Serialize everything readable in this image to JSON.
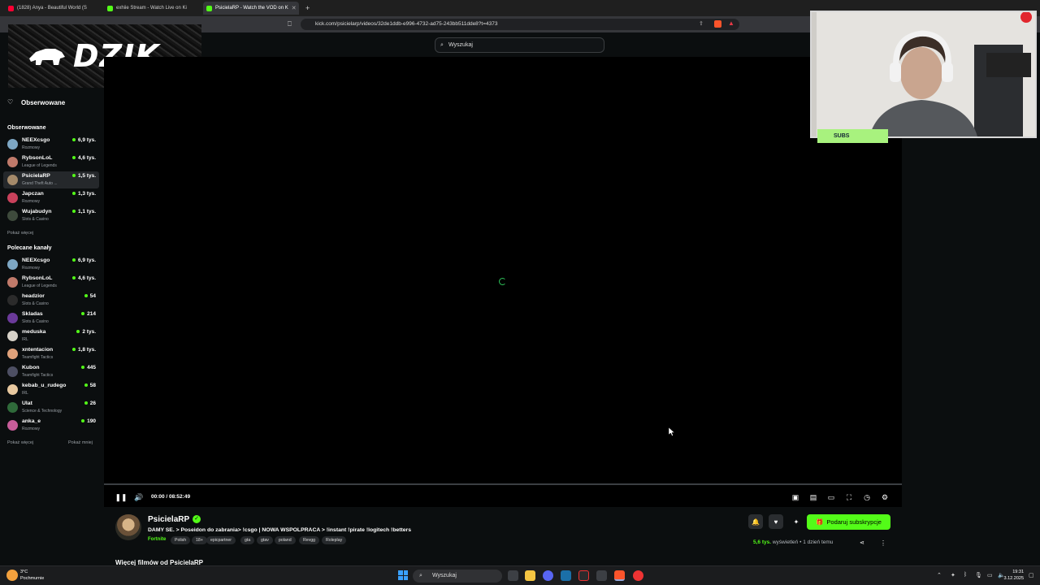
{
  "browser": {
    "tabs": [
      {
        "label": "(1828) Anya - Beautiful World (S",
        "color": "#ff0033"
      },
      {
        "label": "exhiie Stream - Watch Live on Ki",
        "color": "#53fc18"
      },
      {
        "label": "PsicielaRP - Watch the VOD on K",
        "color": "#53fc18"
      }
    ],
    "new_tab": "+",
    "url": "kick.com/psicielarp/videos/32de1ddb-e996-4732-ad75-243bb511dde8?t=4373"
  },
  "logo": {
    "text": "DZIK"
  },
  "search": {
    "placeholder": "Wyszukaj"
  },
  "sidebar": {
    "followed_nav": "Obserwowane",
    "followed_heading": "Obserwowane",
    "followed": [
      {
        "name": "NEEXcsgo",
        "category": "Rozmowy",
        "viewers": "6,9 tys.",
        "color": "#7da7c4"
      },
      {
        "name": "RybsonLoL",
        "category": "League of Legends",
        "viewers": "4,6 tys.",
        "color": "#c07a6a"
      },
      {
        "name": "PsicielaRP",
        "category": "Grand Theft Auto ...",
        "viewers": "1,5 tys.",
        "color": "#a58a6a"
      },
      {
        "name": "Japczan",
        "category": "Rozmowy",
        "viewers": "1,3 tys.",
        "color": "#c9415b"
      },
      {
        "name": "Wujabudyn",
        "category": "Slots & Casino",
        "viewers": "1,1 tys.",
        "color": "#3e4a3c"
      }
    ],
    "show_more_1": "Pokaż więcej",
    "recommended_heading": "Polecane kanały",
    "recommended": [
      {
        "name": "NEEXcsgo",
        "category": "Rozmowy",
        "viewers": "6,9 tys.",
        "color": "#7da7c4"
      },
      {
        "name": "RybsonLoL",
        "category": "League of Legends",
        "viewers": "4,6 tys.",
        "color": "#c07a6a"
      },
      {
        "name": "headzior",
        "category": "Slots & Casino",
        "viewers": "54",
        "color": "#2b2b2b"
      },
      {
        "name": "Skladas",
        "category": "Slots & Casino",
        "viewers": "214",
        "color": "#6b3a9a"
      },
      {
        "name": "meduska",
        "category": "IRL",
        "viewers": "2 tys.",
        "color": "#d7d2c8"
      },
      {
        "name": "xntentacion",
        "category": "Teamfight Tactics",
        "viewers": "1,8 tys.",
        "color": "#e0a27b"
      },
      {
        "name": "Kubon",
        "category": "Teamfight Tactics",
        "viewers": "445",
        "color": "#4d4f63"
      },
      {
        "name": "kebab_u_rudego",
        "category": "IRL",
        "viewers": "58",
        "color": "#e8c9a0"
      },
      {
        "name": "Ulat",
        "category": "Science & Technology",
        "viewers": "26",
        "color": "#2f6a3a"
      },
      {
        "name": "anka_e",
        "category": "Rozmowy",
        "viewers": "190",
        "color": "#c75d9a"
      }
    ],
    "show_more_2": "Pokaż więcej",
    "show_less": "Pokaż mniej"
  },
  "player": {
    "time": "00:00 / 08:52:49",
    "progress_fraction": 0
  },
  "channel": {
    "name": "PsicielaRP",
    "title": "DAMY SE. > Poseidon do zabrania> !csgo   | NOWA WSPOLPRACA > !instant  !pirate !logitech !betters",
    "category": "Fortnite",
    "tags": [
      "Polish",
      "18+",
      "epicpartner",
      "gta",
      "gtav",
      "poland",
      "Revgg",
      "Roleplay"
    ],
    "subscribe_label": "Podaruj subskrypcje",
    "views": "5,6 tys.",
    "views_label": "wyświetleń",
    "separator": "•",
    "age": "1 dzień temu",
    "more_videos": "Więcej filmów od PsicielaRP"
  },
  "overlay": {
    "subs_label": "SUBS"
  },
  "taskbar": {
    "search_placeholder": "Wyszukaj",
    "weather_temp": "3°C",
    "weather_desc": "Pochmurnie",
    "time": "19:31",
    "date": "3.12.2025"
  },
  "colors": {
    "accent": "#53fc18",
    "background": "#0b0e0f"
  }
}
